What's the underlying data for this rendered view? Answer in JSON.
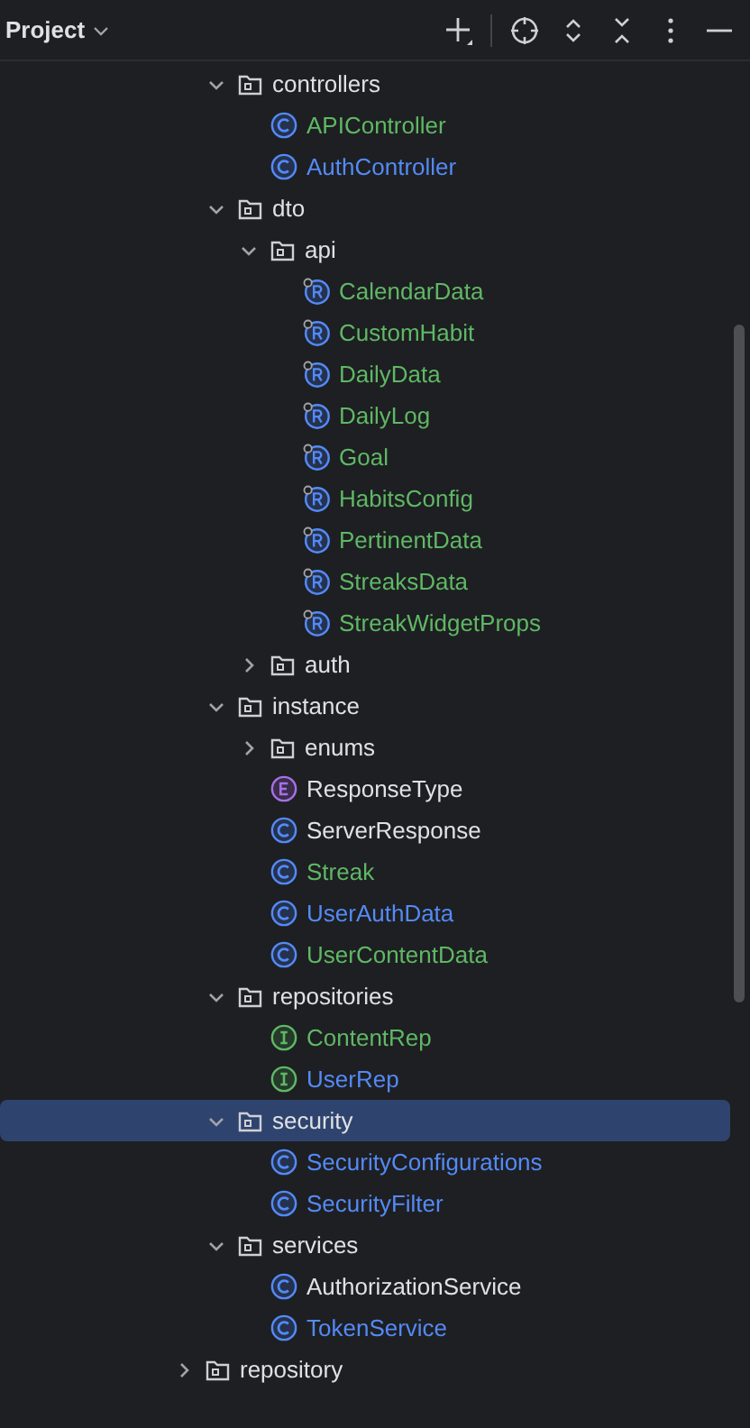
{
  "header": {
    "title": "Project"
  },
  "tree": [
    {
      "children": [
        {
          "name": "controllers",
          "kind": "folder",
          "expanded": true,
          "selected": false,
          "color": "#dfe1e5",
          "children": [
            {
              "name": "APIController",
              "kind": "class",
              "selected": false,
              "color": "#5fb865"
            },
            {
              "name": "AuthController",
              "kind": "class",
              "selected": false,
              "color": "#548af7"
            }
          ]
        },
        {
          "name": "dto",
          "kind": "folder",
          "expanded": true,
          "selected": false,
          "color": "#dfe1e5",
          "children": [
            {
              "name": "api",
              "kind": "folder",
              "expanded": true,
              "selected": false,
              "color": "#dfe1e5",
              "children": [
                {
                  "name": "CalendarData",
                  "kind": "record",
                  "selected": false,
                  "color": "#5fb865"
                },
                {
                  "name": "CustomHabit",
                  "kind": "record",
                  "selected": false,
                  "color": "#5fb865"
                },
                {
                  "name": "DailyData",
                  "kind": "record",
                  "selected": false,
                  "color": "#5fb865"
                },
                {
                  "name": "DailyLog",
                  "kind": "record",
                  "selected": false,
                  "color": "#5fb865"
                },
                {
                  "name": "Goal",
                  "kind": "record",
                  "selected": false,
                  "color": "#5fb865"
                },
                {
                  "name": "HabitsConfig",
                  "kind": "record",
                  "selected": false,
                  "color": "#5fb865"
                },
                {
                  "name": "PertinentData",
                  "kind": "record",
                  "selected": false,
                  "color": "#5fb865"
                },
                {
                  "name": "StreaksData",
                  "kind": "record",
                  "selected": false,
                  "color": "#5fb865"
                },
                {
                  "name": "StreakWidgetProps",
                  "kind": "record",
                  "selected": false,
                  "color": "#5fb865"
                }
              ]
            },
            {
              "name": "auth",
              "kind": "folder",
              "expanded": false,
              "selected": false,
              "color": "#dfe1e5"
            }
          ]
        },
        {
          "name": "instance",
          "kind": "folder",
          "expanded": true,
          "selected": false,
          "color": "#dfe1e5",
          "children": [
            {
              "name": "enums",
              "kind": "folder",
              "expanded": false,
              "selected": false,
              "color": "#dfe1e5"
            },
            {
              "name": "ResponseType",
              "kind": "enum",
              "selected": false,
              "color": "#dfe1e5"
            },
            {
              "name": "ServerResponse",
              "kind": "class",
              "selected": false,
              "color": "#dfe1e5"
            },
            {
              "name": "Streak",
              "kind": "class",
              "selected": false,
              "color": "#5fb865"
            },
            {
              "name": "UserAuthData",
              "kind": "class",
              "selected": false,
              "color": "#548af7"
            },
            {
              "name": "UserContentData",
              "kind": "class",
              "selected": false,
              "color": "#5fb865"
            }
          ]
        },
        {
          "name": "repositories",
          "kind": "folder",
          "expanded": true,
          "selected": false,
          "color": "#dfe1e5",
          "children": [
            {
              "name": "ContentRep",
              "kind": "interface",
              "selected": false,
              "color": "#5fb865"
            },
            {
              "name": "UserRep",
              "kind": "interface",
              "selected": false,
              "color": "#548af7"
            }
          ]
        },
        {
          "name": "security",
          "kind": "folder",
          "expanded": true,
          "selected": true,
          "color": "#dfe1e5",
          "children": [
            {
              "name": "SecurityConfigurations",
              "kind": "class",
              "selected": false,
              "color": "#548af7"
            },
            {
              "name": "SecurityFilter",
              "kind": "class",
              "selected": false,
              "color": "#548af7"
            }
          ]
        },
        {
          "name": "services",
          "kind": "folder",
          "expanded": true,
          "selected": false,
          "color": "#dfe1e5",
          "children": [
            {
              "name": "AuthorizationService",
              "kind": "class",
              "selected": false,
              "color": "#dfe1e5"
            },
            {
              "name": "TokenService",
              "kind": "class",
              "selected": false,
              "color": "#548af7"
            }
          ]
        }
      ]
    },
    {
      "name": "repository",
      "kind": "folder",
      "expanded": false,
      "selected": false,
      "color": "#dfe1e5"
    }
  ]
}
